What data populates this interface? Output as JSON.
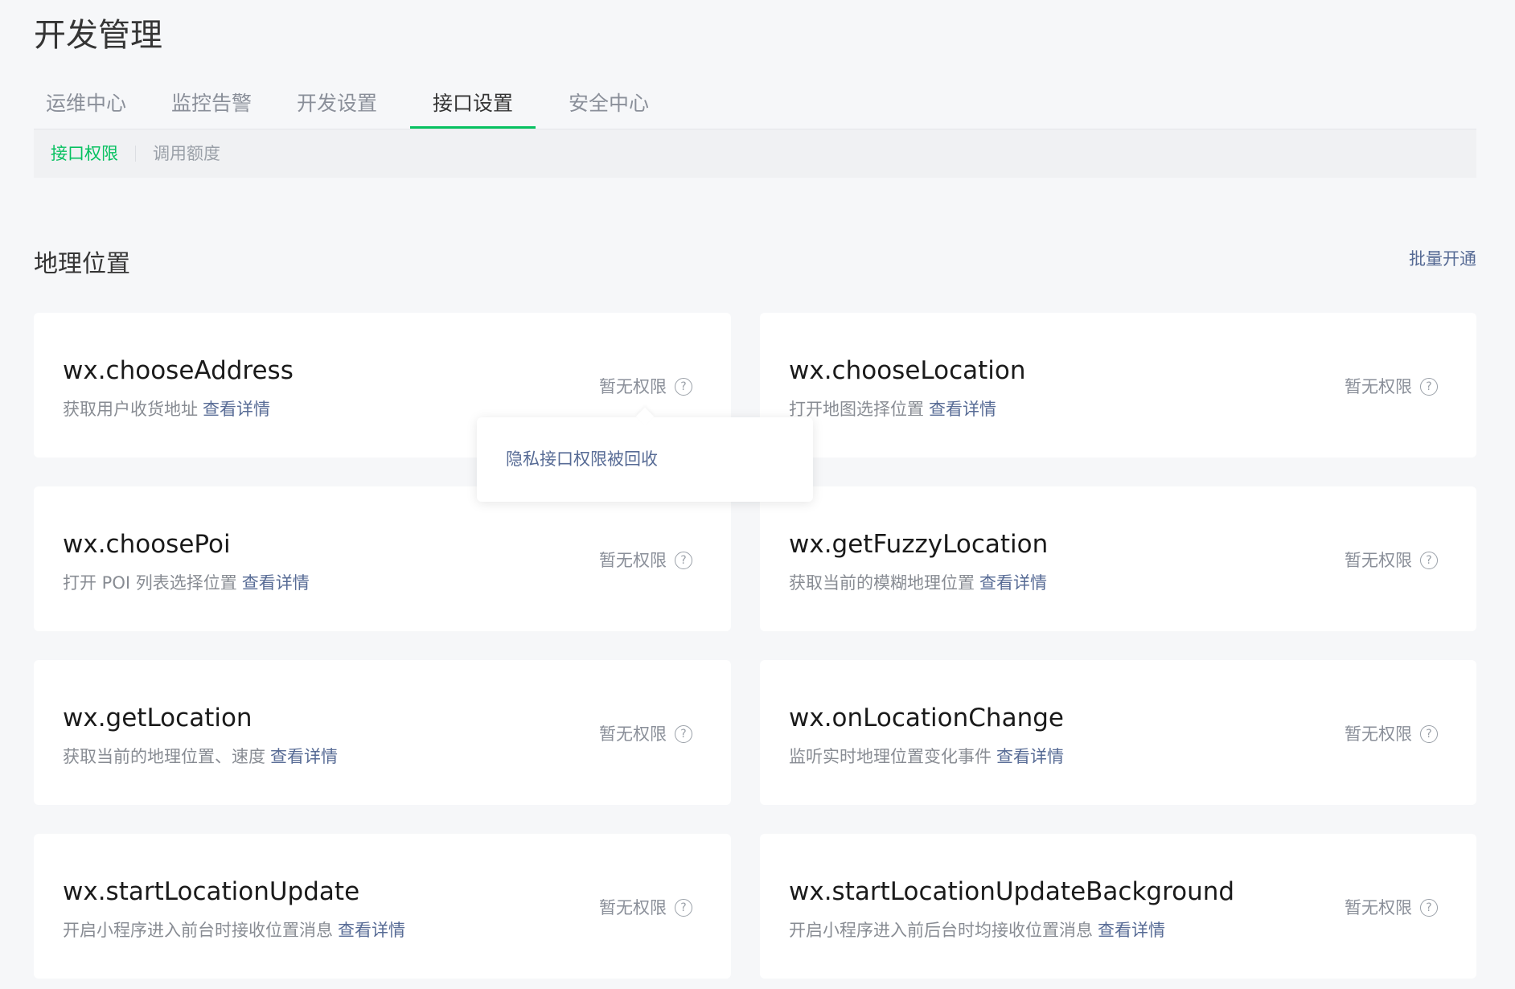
{
  "page": {
    "title": "开发管理"
  },
  "main_tabs": [
    {
      "label": "运维中心"
    },
    {
      "label": "监控告警"
    },
    {
      "label": "开发设置"
    },
    {
      "label": "接口设置",
      "active": true
    },
    {
      "label": "安全中心"
    }
  ],
  "sub_tabs": [
    {
      "label": "接口权限",
      "active": true
    },
    {
      "label": "调用额度"
    }
  ],
  "section": {
    "title": "地理位置",
    "batch_label": "批量开通"
  },
  "detail_label": "查看详情",
  "cards": [
    {
      "name": "wx.chooseAddress",
      "desc": "获取用户收货地址",
      "status": "暂无权限"
    },
    {
      "name": "wx.chooseLocation",
      "desc": "打开地图选择位置",
      "status": "暂无权限"
    },
    {
      "name": "wx.choosePoi",
      "desc": "打开 POI 列表选择位置",
      "status": "暂无权限"
    },
    {
      "name": "wx.getFuzzyLocation",
      "desc": "获取当前的模糊地理位置",
      "status": "暂无权限"
    },
    {
      "name": "wx.getLocation",
      "desc": "获取当前的地理位置、速度",
      "status": "暂无权限"
    },
    {
      "name": "wx.onLocationChange",
      "desc": "监听实时地理位置变化事件",
      "status": "暂无权限"
    },
    {
      "name": "wx.startLocationUpdate",
      "desc": "开启小程序进入前台时接收位置消息",
      "status": "暂无权限"
    },
    {
      "name": "wx.startLocationUpdateBackground",
      "desc": "开启小程序进入前后台时均接收位置消息",
      "status": "暂无权限"
    }
  ],
  "tooltip": {
    "text": "隐私接口权限被回收"
  },
  "colors": {
    "accent": "#07c160",
    "link": "#576b95",
    "background": "#f6f7f9"
  },
  "icons": {
    "help": "question-circle-icon"
  }
}
